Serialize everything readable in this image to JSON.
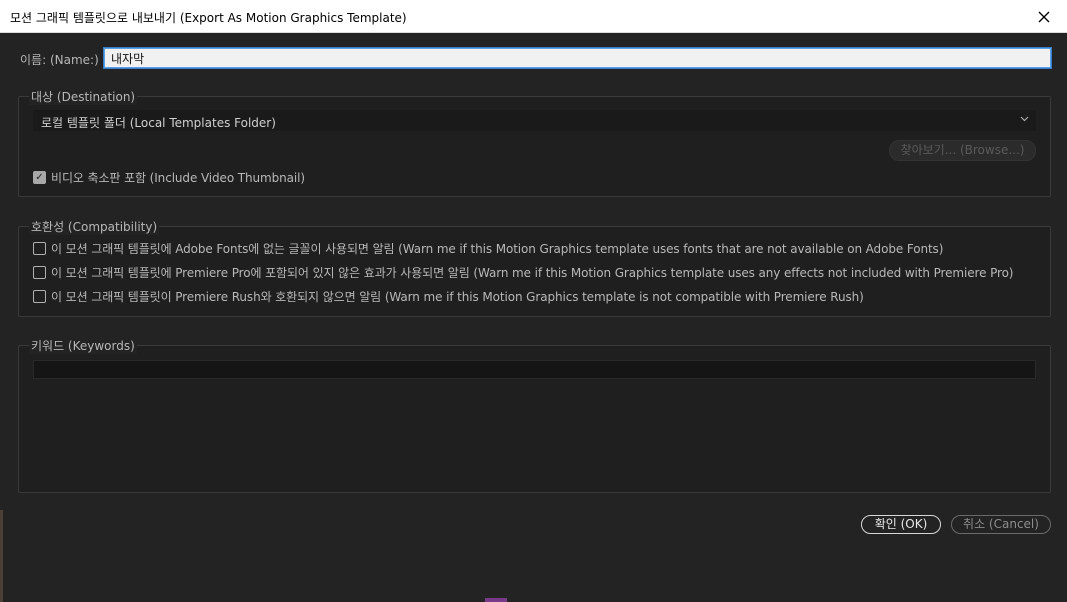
{
  "window": {
    "title": "모션 그래픽 템플릿으로 내보내기 (Export As Motion Graphics Template)",
    "close_icon": "close-icon"
  },
  "name_field": {
    "label": "이름: (Name:)",
    "value": "내자막"
  },
  "destination": {
    "legend": "대상 (Destination)",
    "selected": "로컬 템플릿 폴더 (Local Templates Folder)",
    "browse_label": "찾아보기... (Browse...)",
    "thumbnail_label": "비디오 축소판 포함 (Include Video Thumbnail)",
    "thumbnail_checked": true
  },
  "compatibility": {
    "legend": "호환성 (Compatibility)",
    "options": [
      {
        "label": "이 모션 그래픽 템플릿에 Adobe Fonts에 없는 글꼴이 사용되면 알림 (Warn me if this Motion Graphics template uses fonts that are not available on Adobe Fonts)",
        "checked": false
      },
      {
        "label": "이 모션 그래픽 템플릿에 Premiere Pro에 포함되어 있지 않은 효과가 사용되면 알림 (Warn me if this Motion Graphics template uses any effects not included with Premiere Pro)",
        "checked": false
      },
      {
        "label": "이 모션 그래픽 템플릿이 Premiere Rush와 호환되지 않으면 알림 (Warn me if this Motion Graphics template is not compatible with Premiere Rush)",
        "checked": false
      }
    ]
  },
  "keywords": {
    "legend": "키워드 (Keywords)",
    "value": ""
  },
  "buttons": {
    "ok": "확인 (OK)",
    "cancel": "취소 (Cancel)"
  },
  "colors": {
    "dialog_bg": "#232323",
    "titlebar_bg": "#ffffff",
    "focus_accent": "#3a7ccc"
  }
}
